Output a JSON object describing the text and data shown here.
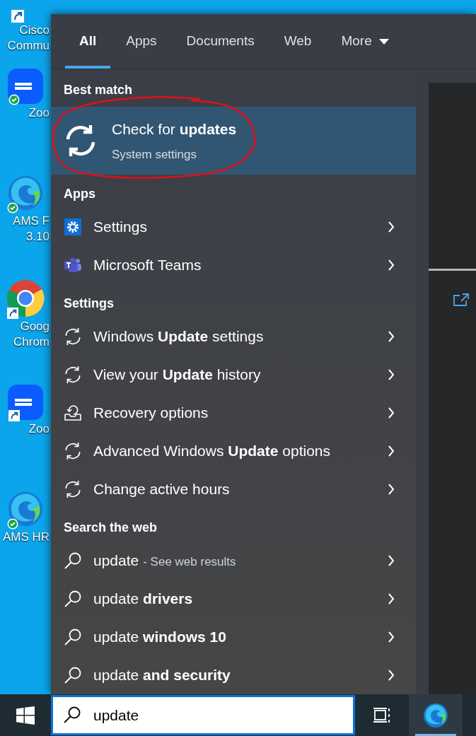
{
  "desktop_icons": [
    {
      "kind": "cisco",
      "lines": [
        "Cisco",
        "Commu"
      ]
    },
    {
      "kind": "zoom",
      "lines": [
        "Zoo"
      ]
    },
    {
      "kind": "edge",
      "lines": [
        "AMS F",
        "3.10"
      ]
    },
    {
      "kind": "chrome",
      "lines": [
        "Goog",
        "Chrom"
      ]
    },
    {
      "kind": "zoom",
      "lines": [
        "Zoo"
      ]
    },
    {
      "kind": "edge",
      "lines": [
        "AMS HR"
      ]
    }
  ],
  "tabs": [
    {
      "label": "All",
      "selected": true
    },
    {
      "label": "Apps",
      "selected": false
    },
    {
      "label": "Documents",
      "selected": false
    },
    {
      "label": "Web",
      "selected": false
    },
    {
      "label": "More",
      "selected": false,
      "dropdown": true
    }
  ],
  "best_match": {
    "heading": "Best match",
    "title": "Check for **updates**",
    "subtitle": "System settings",
    "circled": true
  },
  "sections": [
    {
      "heading": "Apps",
      "items": [
        {
          "kind": "gear",
          "text": "Settings"
        },
        {
          "kind": "teams",
          "text": "Microsoft Teams"
        }
      ]
    },
    {
      "heading": "Settings",
      "items": [
        {
          "kind": "sync",
          "text": "Windows **Update** settings"
        },
        {
          "kind": "sync",
          "text": "View your **Update** history"
        },
        {
          "kind": "recovery",
          "text": "Recovery options"
        },
        {
          "kind": "sync",
          "text": "Advanced Windows **Update** options"
        },
        {
          "kind": "sync",
          "text": "Change active hours"
        }
      ]
    },
    {
      "heading": "Search the web",
      "items": [
        {
          "kind": "search",
          "text": "update",
          "hint": "- See web results"
        },
        {
          "kind": "search",
          "text": "update **drivers**"
        },
        {
          "kind": "search",
          "text": "update **windows 10**"
        },
        {
          "kind": "search",
          "text": "update **and security**"
        }
      ]
    }
  ],
  "search_box": {
    "value": "update"
  }
}
